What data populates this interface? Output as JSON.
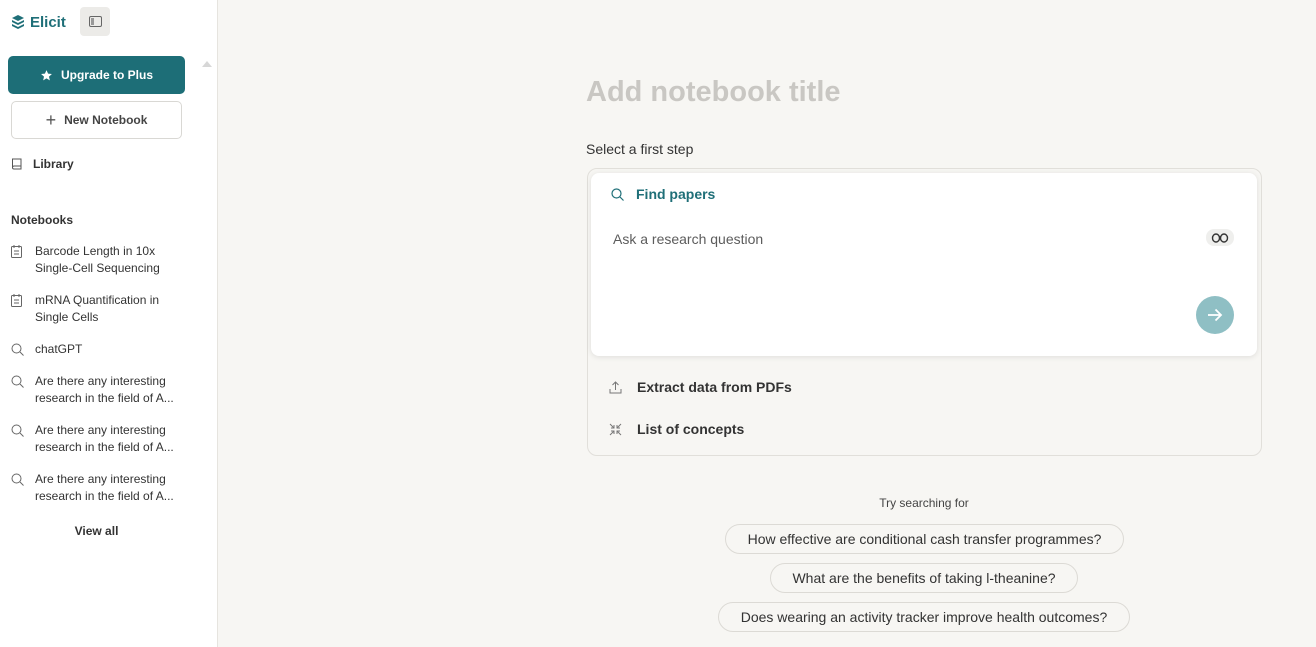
{
  "sidebar": {
    "brand": "Elicit",
    "upgrade_label": "Upgrade to Plus",
    "new_notebook_label": "New Notebook",
    "library_label": "Library",
    "notebooks_heading": "Notebooks",
    "notebooks": [
      {
        "icon": "notebook-icon",
        "line1": "Barcode Length in 10x",
        "line2": "Single-Cell Sequencing"
      },
      {
        "icon": "notebook-icon",
        "line1": "mRNA Quantification in",
        "line2": "Single Cells"
      },
      {
        "icon": "search-icon",
        "line1": "chatGPT",
        "line2": ""
      },
      {
        "icon": "search-icon",
        "line1": "Are there any interesting",
        "line2": "research in the field of A..."
      },
      {
        "icon": "search-icon",
        "line1": "Are there any interesting",
        "line2": "research in the field of A..."
      },
      {
        "icon": "search-icon",
        "line1": "Are there any interesting",
        "line2": "research in the field of A..."
      }
    ],
    "view_all_label": "View all"
  },
  "main": {
    "title_placeholder": "Add notebook title",
    "select_step_label": "Select a first step",
    "find_papers": {
      "label": "Find papers",
      "question_placeholder": "Ask a research question"
    },
    "steps": [
      {
        "icon": "upload-icon",
        "label": "Extract data from PDFs"
      },
      {
        "icon": "concepts-icon",
        "label": "List of concepts"
      }
    ],
    "try_searching_label": "Try searching for",
    "suggestions": [
      "How effective are conditional cash transfer programmes?",
      "What are the benefits of taking l-theanine?",
      "Does wearing an activity tracker improve health outcomes?"
    ]
  },
  "colors": {
    "accent": "#1d6e77",
    "submit_disabled": "#8fbfc4",
    "background": "#f7f6f3"
  }
}
